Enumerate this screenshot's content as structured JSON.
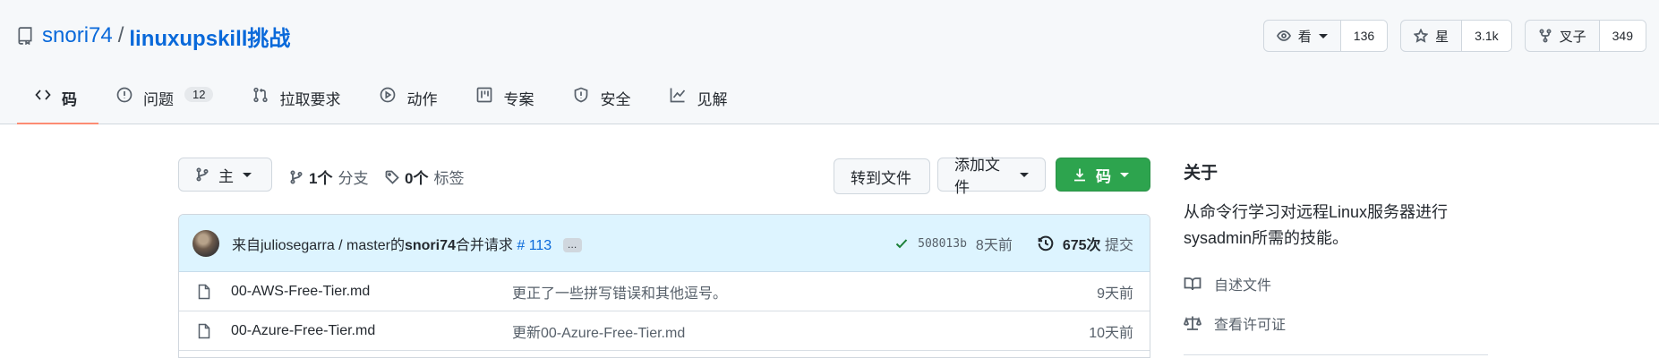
{
  "repo": {
    "owner": "snori74",
    "separator": "/",
    "name": "linuxupskill挑战"
  },
  "actions": {
    "watch": {
      "label": "看",
      "count": "136"
    },
    "star": {
      "label": "星",
      "count": "3.1k"
    },
    "fork": {
      "label": "叉子",
      "count": "349"
    }
  },
  "tabs": [
    {
      "label": "码",
      "icon": "code-icon"
    },
    {
      "label": "问题",
      "badge": "12",
      "icon": "issue-icon"
    },
    {
      "label": "拉取要求",
      "icon": "pull-request-icon"
    },
    {
      "label": "动作",
      "icon": "play-icon"
    },
    {
      "label": "专案",
      "icon": "project-icon"
    },
    {
      "label": "安全",
      "icon": "shield-icon"
    },
    {
      "label": "见解",
      "icon": "graph-icon"
    }
  ],
  "toolbar": {
    "branch": "主",
    "branches_count": "1个",
    "branches_label": "分支",
    "tags_count": "0个",
    "tags_label": "标签",
    "goto_file": "转到文件",
    "add_file": "添加文件",
    "code": "码"
  },
  "commit": {
    "prefix": "来自juliosegarra / master的",
    "author": "snori74",
    "action": "合并请求",
    "pr": "# 113",
    "ellipsis": "…",
    "sha": "508013b",
    "time": "8天前",
    "count": "675次",
    "count_label": "提交"
  },
  "files": [
    {
      "name": "00-AWS-Free-Tier.md",
      "message": "更正了一些拼写错误和其他逗号。",
      "time": "9天前"
    },
    {
      "name": "00-Azure-Free-Tier.md",
      "message": "更新00-Azure-Free-Tier.md",
      "time": "10天前"
    }
  ],
  "about": {
    "heading": "关于",
    "description": "从命令行学习对远程Linux服务器进行sysadmin所需的技能。",
    "readme": "自述文件",
    "license": "查看许可证"
  },
  "colors": {
    "link": "#0969da",
    "primary_button": "#2da44e",
    "tab_underline": "#fd8c73"
  }
}
